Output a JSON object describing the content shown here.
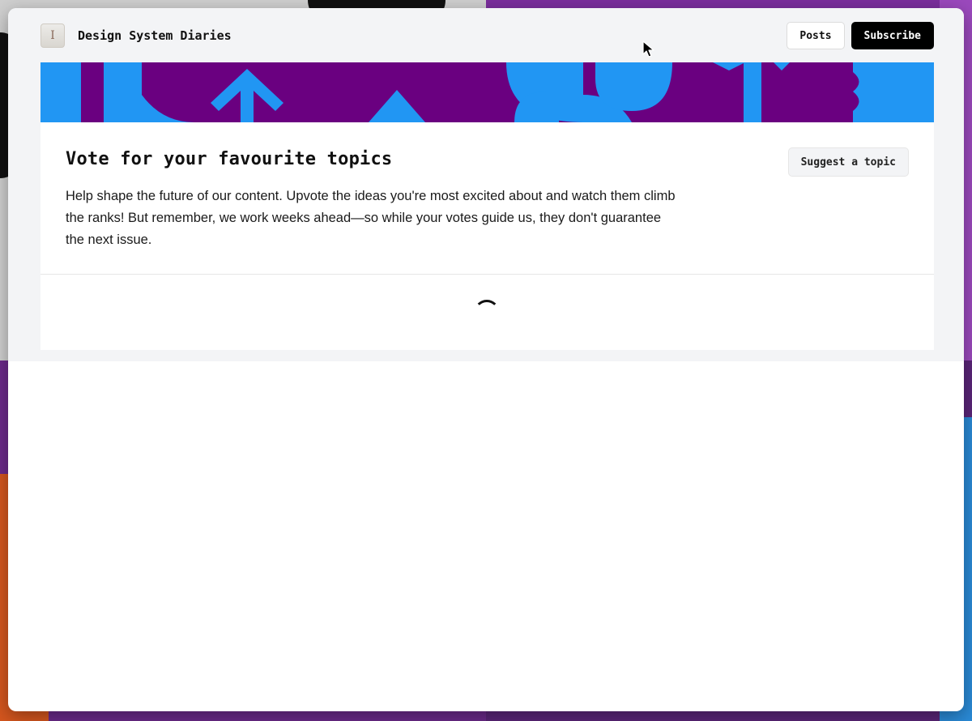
{
  "header": {
    "logo_glyph": "I",
    "site_title": "Design System Diaries",
    "posts_label": "Posts",
    "subscribe_label": "Subscribe"
  },
  "topics": {
    "title": "Vote for your favourite topics",
    "description": "Help shape the future of our content. Upvote the ideas you're most excited about and watch them climb the ranks! But remember, we work weeks ahead—so while your votes guide us, they don't guarantee the next issue.",
    "suggest_label": "Suggest a topic"
  },
  "colors": {
    "banner_purple": "#6a0080",
    "banner_blue": "#2196f3",
    "page_bg": "#f3f4f6",
    "primary_button": "#000000"
  },
  "icons": {
    "logo": "cursor-i-logo-icon",
    "loading": "loading-spinner-icon",
    "pointer": "mouse-pointer-icon"
  }
}
